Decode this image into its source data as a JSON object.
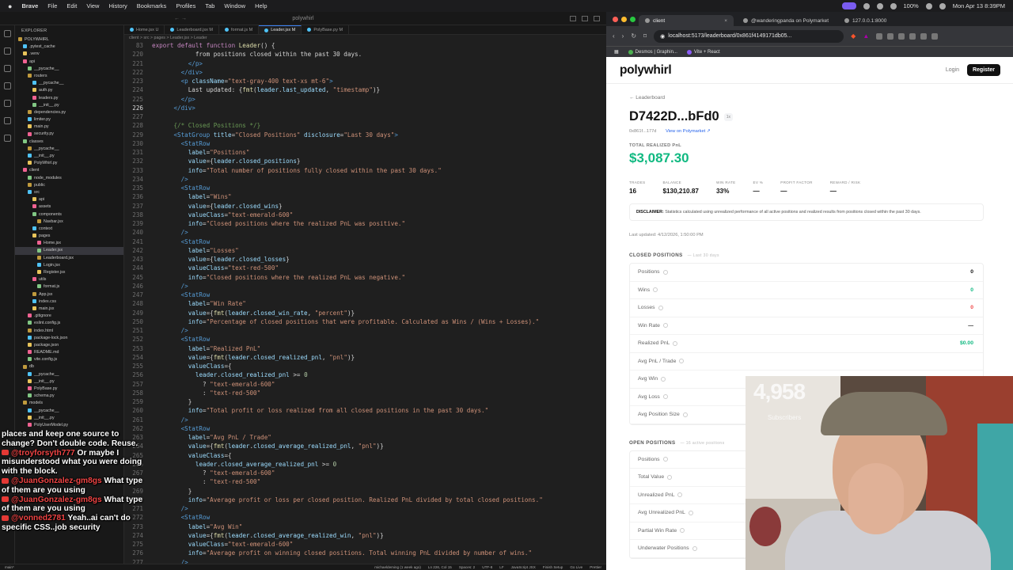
{
  "menubar": {
    "app": "Brave",
    "items": [
      "File",
      "Edit",
      "View",
      "History",
      "Bookmarks",
      "Profiles",
      "Tab",
      "Window",
      "Help"
    ],
    "battery": "100%",
    "datetime": "Mon Apr 13  8:39PM"
  },
  "vscode": {
    "title": "polywhirl",
    "explorer_header": "EXPLORER",
    "tree": [
      {
        "label": "POLYWHIRL",
        "indent": 0
      },
      {
        "label": ".pytest_cache",
        "indent": 1
      },
      {
        "label": ".venv",
        "indent": 1
      },
      {
        "label": "api",
        "indent": 1
      },
      {
        "label": "__pycache__",
        "indent": 2
      },
      {
        "label": "routers",
        "indent": 2
      },
      {
        "label": "__pycache__",
        "indent": 3
      },
      {
        "label": "auth.py",
        "indent": 3
      },
      {
        "label": "leaders.py",
        "indent": 3
      },
      {
        "label": "__init__.py",
        "indent": 3
      },
      {
        "label": "dependencies.py",
        "indent": 2
      },
      {
        "label": "limiter.py",
        "indent": 2
      },
      {
        "label": "main.py",
        "indent": 2
      },
      {
        "label": "security.py",
        "indent": 2
      },
      {
        "label": "classes",
        "indent": 1
      },
      {
        "label": "__pycache__",
        "indent": 2
      },
      {
        "label": "__init__.py",
        "indent": 2
      },
      {
        "label": "PolyWhirl.py",
        "indent": 2
      },
      {
        "label": "client",
        "indent": 1
      },
      {
        "label": "node_modules",
        "indent": 2
      },
      {
        "label": "public",
        "indent": 2
      },
      {
        "label": "src",
        "indent": 2
      },
      {
        "label": "api",
        "indent": 3
      },
      {
        "label": "assets",
        "indent": 3
      },
      {
        "label": "components",
        "indent": 3
      },
      {
        "label": "Navbar.jsx",
        "indent": 4
      },
      {
        "label": "context",
        "indent": 3
      },
      {
        "label": "pages",
        "indent": 3
      },
      {
        "label": "Home.jsx",
        "indent": 4
      },
      {
        "label": "Leader.jsx",
        "indent": 4
      },
      {
        "label": "Leaderboard.jsx",
        "indent": 4
      },
      {
        "label": "Login.jsx",
        "indent": 4
      },
      {
        "label": "Register.jsx",
        "indent": 4
      },
      {
        "label": "utils",
        "indent": 3
      },
      {
        "label": "format.js",
        "indent": 4
      },
      {
        "label": "App.jsx",
        "indent": 3
      },
      {
        "label": "index.css",
        "indent": 3
      },
      {
        "label": "main.jsx",
        "indent": 3
      },
      {
        "label": ".gitignore",
        "indent": 2
      },
      {
        "label": "eslint.config.js",
        "indent": 2
      },
      {
        "label": "index.html",
        "indent": 2
      },
      {
        "label": "package-lock.json",
        "indent": 2
      },
      {
        "label": "package.json",
        "indent": 2
      },
      {
        "label": "README.md",
        "indent": 2
      },
      {
        "label": "vite.config.js",
        "indent": 2
      },
      {
        "label": "db",
        "indent": 1
      },
      {
        "label": "__pycache__",
        "indent": 2
      },
      {
        "label": "__init__.py",
        "indent": 2
      },
      {
        "label": "PolyBase.py",
        "indent": 2
      },
      {
        "label": "schema.py",
        "indent": 2
      },
      {
        "label": "models",
        "indent": 1
      },
      {
        "label": "__pycache__",
        "indent": 2
      },
      {
        "label": "__init__.py",
        "indent": 2
      },
      {
        "label": "PolyUserModel.py",
        "indent": 2
      }
    ],
    "tabs": [
      "Home.jsx U",
      "Leaderboard.jsx M",
      "format.js M",
      "Leader.jsx M",
      "PolyBase.py M"
    ],
    "active_tab_index": 3,
    "breadcrumb": "client > src > pages > Leader.jsx > Leader",
    "status": {
      "branch": "main*",
      "author": "michaeldeming (1 week ago)",
      "position": "Ln 226, Col 15",
      "spaces": "Spaces: 2",
      "encoding": "UTF-8",
      "eol": "LF",
      "lang": "JavaScript JSX",
      "ext": "Finish Setup",
      "golive": "Go Live",
      "prettier": "Prettier"
    }
  },
  "code_lines": [
    {
      "n": "83",
      "h": "<span class='k'>export default function</span> <span class='f'>Leader</span><span class='o'>() {</span>"
    },
    {
      "n": "220",
      "h": "            from positions closed within the past 30 days."
    },
    {
      "n": "221",
      "h": "          <span class='t'>&lt;/p&gt;</span>"
    },
    {
      "n": "222",
      "h": "        <span class='t'>&lt;/div&gt;</span>"
    },
    {
      "n": "223",
      "h": "        <span class='t'>&lt;p</span> <span class='a'>className</span>=<span class='s'>\"text-gray-400 text-xs mt-6\"</span><span class='t'>&gt;</span>"
    },
    {
      "n": "224",
      "h": "          Last updated: {<span class='f'>fmt</span>(<span class='a'>leader</span>.<span class='a'>last_updated</span>, <span class='s'>\"timestamp\"</span>)}"
    },
    {
      "n": "225",
      "h": "        <span class='t'>&lt;/p&gt;</span>"
    },
    {
      "n": "226",
      "h": "      <span class='t'>&lt;/div&gt;</span>",
      "cur": true
    },
    {
      "n": "227",
      "h": ""
    },
    {
      "n": "228",
      "h": "      <span class='c'>{/* Closed Positions */}</span>"
    },
    {
      "n": "229",
      "h": "      <span class='t'>&lt;StatGroup</span> <span class='a'>title</span>=<span class='s'>\"Closed Positions\"</span> <span class='a'>disclosure</span>=<span class='s'>\"Last 30 days\"</span><span class='t'>&gt;</span>"
    },
    {
      "n": "230",
      "h": "        <span class='t'>&lt;StatRow</span>"
    },
    {
      "n": "231",
      "h": "          <span class='a'>label</span>=<span class='s'>\"Positions\"</span>"
    },
    {
      "n": "232",
      "h": "          <span class='a'>value</span>={<span class='a'>leader</span>.<span class='a'>closed_positions</span>}"
    },
    {
      "n": "233",
      "h": "          <span class='a'>info</span>=<span class='s'>\"Total number of positions fully closed within the past 30 days.\"</span>"
    },
    {
      "n": "234",
      "h": "        <span class='t'>/&gt;</span>"
    },
    {
      "n": "235",
      "h": "        <span class='t'>&lt;StatRow</span>"
    },
    {
      "n": "236",
      "h": "          <span class='a'>label</span>=<span class='s'>\"Wins\"</span>"
    },
    {
      "n": "237",
      "h": "          <span class='a'>value</span>={<span class='a'>leader</span>.<span class='a'>closed_wins</span>}"
    },
    {
      "n": "238",
      "h": "          <span class='a'>valueClass</span>=<span class='s'>\"text-emerald-600\"</span>"
    },
    {
      "n": "239",
      "h": "          <span class='a'>info</span>=<span class='s'>\"Closed positions where the realized PnL was positive.\"</span>"
    },
    {
      "n": "240",
      "h": "        <span class='t'>/&gt;</span>"
    },
    {
      "n": "241",
      "h": "        <span class='t'>&lt;StatRow</span>"
    },
    {
      "n": "242",
      "h": "          <span class='a'>label</span>=<span class='s'>\"Losses\"</span>"
    },
    {
      "n": "243",
      "h": "          <span class='a'>value</span>={<span class='a'>leader</span>.<span class='a'>closed_losses</span>}"
    },
    {
      "n": "244",
      "h": "          <span class='a'>valueClass</span>=<span class='s'>\"text-red-500\"</span>"
    },
    {
      "n": "245",
      "h": "          <span class='a'>info</span>=<span class='s'>\"Closed positions where the realized PnL was negative.\"</span>"
    },
    {
      "n": "246",
      "h": "        <span class='t'>/&gt;</span>"
    },
    {
      "n": "247",
      "h": "        <span class='t'>&lt;StatRow</span>"
    },
    {
      "n": "248",
      "h": "          <span class='a'>label</span>=<span class='s'>\"Win Rate\"</span>"
    },
    {
      "n": "249",
      "h": "          <span class='a'>value</span>={<span class='f'>fmt</span>(<span class='a'>leader</span>.<span class='a'>closed_win_rate</span>, <span class='s'>\"percent\"</span>)}"
    },
    {
      "n": "250",
      "h": "          <span class='a'>info</span>=<span class='s'>\"Percentage of closed positions that were profitable. Calculated as Wins / (Wins + Losses).\"</span>"
    },
    {
      "n": "251",
      "h": "        <span class='t'>/&gt;</span>"
    },
    {
      "n": "252",
      "h": "        <span class='t'>&lt;StatRow</span>"
    },
    {
      "n": "253",
      "h": "          <span class='a'>label</span>=<span class='s'>\"Realized PnL\"</span>"
    },
    {
      "n": "254",
      "h": "          <span class='a'>value</span>={<span class='f'>fmt</span>(<span class='a'>leader</span>.<span class='a'>closed_realized_pnl</span>, <span class='s'>\"pnl\"</span>)}"
    },
    {
      "n": "255",
      "h": "          <span class='a'>valueClass</span>={"
    },
    {
      "n": "256",
      "h": "            <span class='a'>leader</span>.<span class='a'>closed_realized_pnl</span> &gt;= <span class='n'>0</span>"
    },
    {
      "n": "257",
      "h": "              ? <span class='s'>\"text-emerald-600\"</span>"
    },
    {
      "n": "258",
      "h": "              : <span class='s'>\"text-red-500\"</span>"
    },
    {
      "n": "259",
      "h": "          }"
    },
    {
      "n": "260",
      "h": "          <span class='a'>info</span>=<span class='s'>\"Total profit or loss realized from all closed positions in the past 30 days.\"</span>"
    },
    {
      "n": "261",
      "h": "        <span class='t'>/&gt;</span>"
    },
    {
      "n": "262",
      "h": "        <span class='t'>&lt;StatRow</span>"
    },
    {
      "n": "263",
      "h": "          <span class='a'>label</span>=<span class='s'>\"Avg PnL / Trade\"</span>"
    },
    {
      "n": "264",
      "h": "          <span class='a'>value</span>={<span class='f'>fmt</span>(<span class='a'>leader</span>.<span class='a'>closed_average_realized_pnl</span>, <span class='s'>\"pnl\"</span>)}"
    },
    {
      "n": "265",
      "h": "          <span class='a'>valueClass</span>={"
    },
    {
      "n": "266",
      "h": "            <span class='a'>leader</span>.<span class='a'>closed_average_realized_pnl</span> &gt;= <span class='n'>0</span>"
    },
    {
      "n": "267",
      "h": "              ? <span class='s'>\"text-emerald-600\"</span>"
    },
    {
      "n": "268",
      "h": "              : <span class='s'>\"text-red-500\"</span>"
    },
    {
      "n": "269",
      "h": "          }"
    },
    {
      "n": "270",
      "h": "          <span class='a'>info</span>=<span class='s'>\"Average profit or loss per closed position. Realized PnL divided by total closed positions.\"</span>"
    },
    {
      "n": "271",
      "h": "        <span class='t'>/&gt;</span>"
    },
    {
      "n": "272",
      "h": "        <span class='t'>&lt;StatRow</span>"
    },
    {
      "n": "273",
      "h": "          <span class='a'>label</span>=<span class='s'>\"Avg Win\"</span>"
    },
    {
      "n": "274",
      "h": "          <span class='a'>value</span>={<span class='f'>fmt</span>(<span class='a'>leader</span>.<span class='a'>closed_average_realized_win</span>, <span class='s'>\"pnl\"</span>)}"
    },
    {
      "n": "275",
      "h": "          <span class='a'>valueClass</span>=<span class='s'>\"text-emerald-600\"</span>"
    },
    {
      "n": "276",
      "h": "          <span class='a'>info</span>=<span class='s'>\"Average profit on winning closed positions. Total winning PnL divided by number of wins.\"</span>"
    },
    {
      "n": "277",
      "h": "        <span class='t'>/&gt;</span>"
    }
  ],
  "chat": [
    {
      "user": "",
      "text": "places and keep one source to change? Don't double code. Reuse."
    },
    {
      "user": "@troyforsyth777",
      "text": " Or maybe I misunderstood what you were doing with the block."
    },
    {
      "user": "@JuanGonzalez-gm8gs",
      "text": " What type of them are you using"
    },
    {
      "user": "@JuanGonzalez-gm8gs",
      "text": " What type of them are you using"
    },
    {
      "user": "@vonned2781",
      "text": " Yeah..ai can't do specific CSS..job security"
    }
  ],
  "browser": {
    "tabs": [
      {
        "label": "client",
        "active": true
      },
      {
        "label": "@wanderingpanda on Polymarket",
        "active": false
      },
      {
        "label": "127.0.0.1:8000",
        "active": false
      }
    ],
    "url": "localhost:5173/leaderboard/0x861f4149171db05...",
    "bookmarks": [
      "Desmos | Graphin...",
      "Vite + React"
    ]
  },
  "page": {
    "logo": "polywhirl",
    "login": "Login",
    "register": "Register",
    "back": "← Leaderboard",
    "address": "D7422D...bFd0",
    "address_tag": "1x",
    "short_addr": "0x861f...177d",
    "polymarket_link": "View on Polymarket ↗",
    "pnl_label": "TOTAL REALIZED PnL",
    "pnl_value": "$3,087.30",
    "metrics": [
      {
        "label": "TRADES",
        "value": "16"
      },
      {
        "label": "BALANCE",
        "value": "$130,210.87"
      },
      {
        "label": "WIN RATE",
        "value": "33%"
      },
      {
        "label": "EV %",
        "value": "—"
      },
      {
        "label": "PROFIT FACTOR",
        "value": "—"
      },
      {
        "label": "REWARD / RISK",
        "value": "—"
      }
    ],
    "disclaimer_title": "DISCLAIMER:",
    "disclaimer_text": " Statistics calculated using unrealized performance of all active positions and realized results from positions closed within the past 30 days.",
    "last_updated": "Last updated: 4/12/2026, 1:50:00 PM",
    "closed_title": "CLOSED POSITIONS",
    "closed_sub": "— Last 30 days",
    "closed_rows": [
      {
        "label": "Positions",
        "value": "0",
        "cls": ""
      },
      {
        "label": "Wins",
        "value": "0",
        "cls": "green"
      },
      {
        "label": "Losses",
        "value": "0",
        "cls": "red"
      },
      {
        "label": "Win Rate",
        "value": "—",
        "cls": ""
      },
      {
        "label": "Realized PnL",
        "value": "$0.00",
        "cls": "green"
      },
      {
        "label": "Avg PnL / Trade",
        "value": "",
        "cls": ""
      },
      {
        "label": "Avg Win",
        "value": "",
        "cls": ""
      },
      {
        "label": "Avg Loss",
        "value": "",
        "cls": ""
      },
      {
        "label": "Avg Position Size",
        "value": "",
        "cls": ""
      }
    ],
    "open_title": "OPEN POSITIONS",
    "open_sub": "— 16 active positions",
    "open_rows": [
      {
        "label": "Positions"
      },
      {
        "label": "Total Value"
      },
      {
        "label": "Unrealized PnL"
      },
      {
        "label": "Avg Unrealized PnL"
      },
      {
        "label": "Partial Win Rate"
      },
      {
        "label": "Underwater Positions"
      }
    ]
  },
  "webcam": {
    "sub_count": "4,958",
    "sub_label": "Subscribers"
  }
}
